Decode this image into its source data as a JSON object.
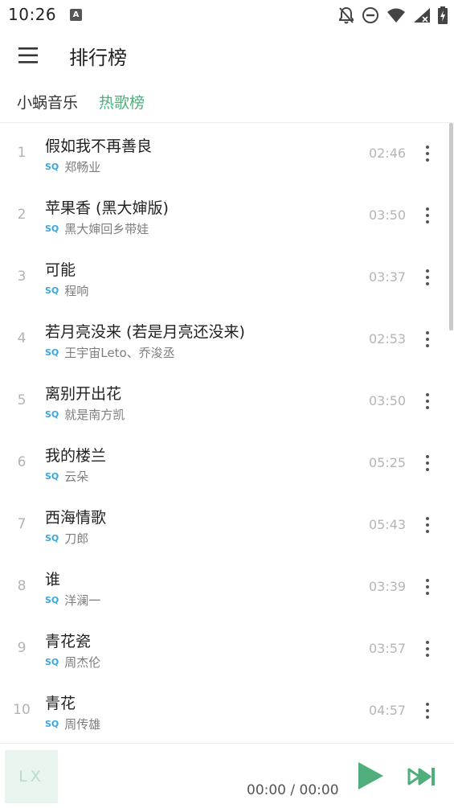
{
  "status_bar": {
    "time": "10:26",
    "app_badge": "A"
  },
  "header": {
    "title": "排行榜",
    "menu_icon": "hamburger-menu-icon"
  },
  "tabs": {
    "source": "小蜗音乐",
    "board": "热歌榜",
    "active_color": "#4fae7b"
  },
  "songs": [
    {
      "rank": "1",
      "title": "假如我不再善良",
      "quality": "SQ",
      "artist": "郑畅业",
      "duration": "02:46"
    },
    {
      "rank": "2",
      "title": "苹果香 (黑大婶版)",
      "quality": "SQ",
      "artist": "黑大婶回乡带娃",
      "duration": "03:50"
    },
    {
      "rank": "3",
      "title": "可能",
      "quality": "SQ",
      "artist": "程响",
      "duration": "03:37"
    },
    {
      "rank": "4",
      "title": "若月亮没来 (若是月亮还没来)",
      "quality": "SQ",
      "artist": "王宇宙Leto、乔浚丞",
      "duration": "02:53"
    },
    {
      "rank": "5",
      "title": "离别开出花",
      "quality": "SQ",
      "artist": "就是南方凯",
      "duration": "03:50"
    },
    {
      "rank": "6",
      "title": "我的楼兰",
      "quality": "SQ",
      "artist": "云朵",
      "duration": "05:25"
    },
    {
      "rank": "7",
      "title": "西海情歌",
      "quality": "SQ",
      "artist": "刀郎",
      "duration": "05:43"
    },
    {
      "rank": "8",
      "title": "谁",
      "quality": "SQ",
      "artist": "洋澜一",
      "duration": "03:39"
    },
    {
      "rank": "9",
      "title": "青花瓷",
      "quality": "SQ",
      "artist": "周杰伦",
      "duration": "03:57"
    },
    {
      "rank": "10",
      "title": "青花",
      "quality": "SQ",
      "artist": "周传雄",
      "duration": "04:57"
    }
  ],
  "player": {
    "cover_text": "LX",
    "time": "00:00 / 00:00",
    "accent_color": "#4fae7b"
  }
}
